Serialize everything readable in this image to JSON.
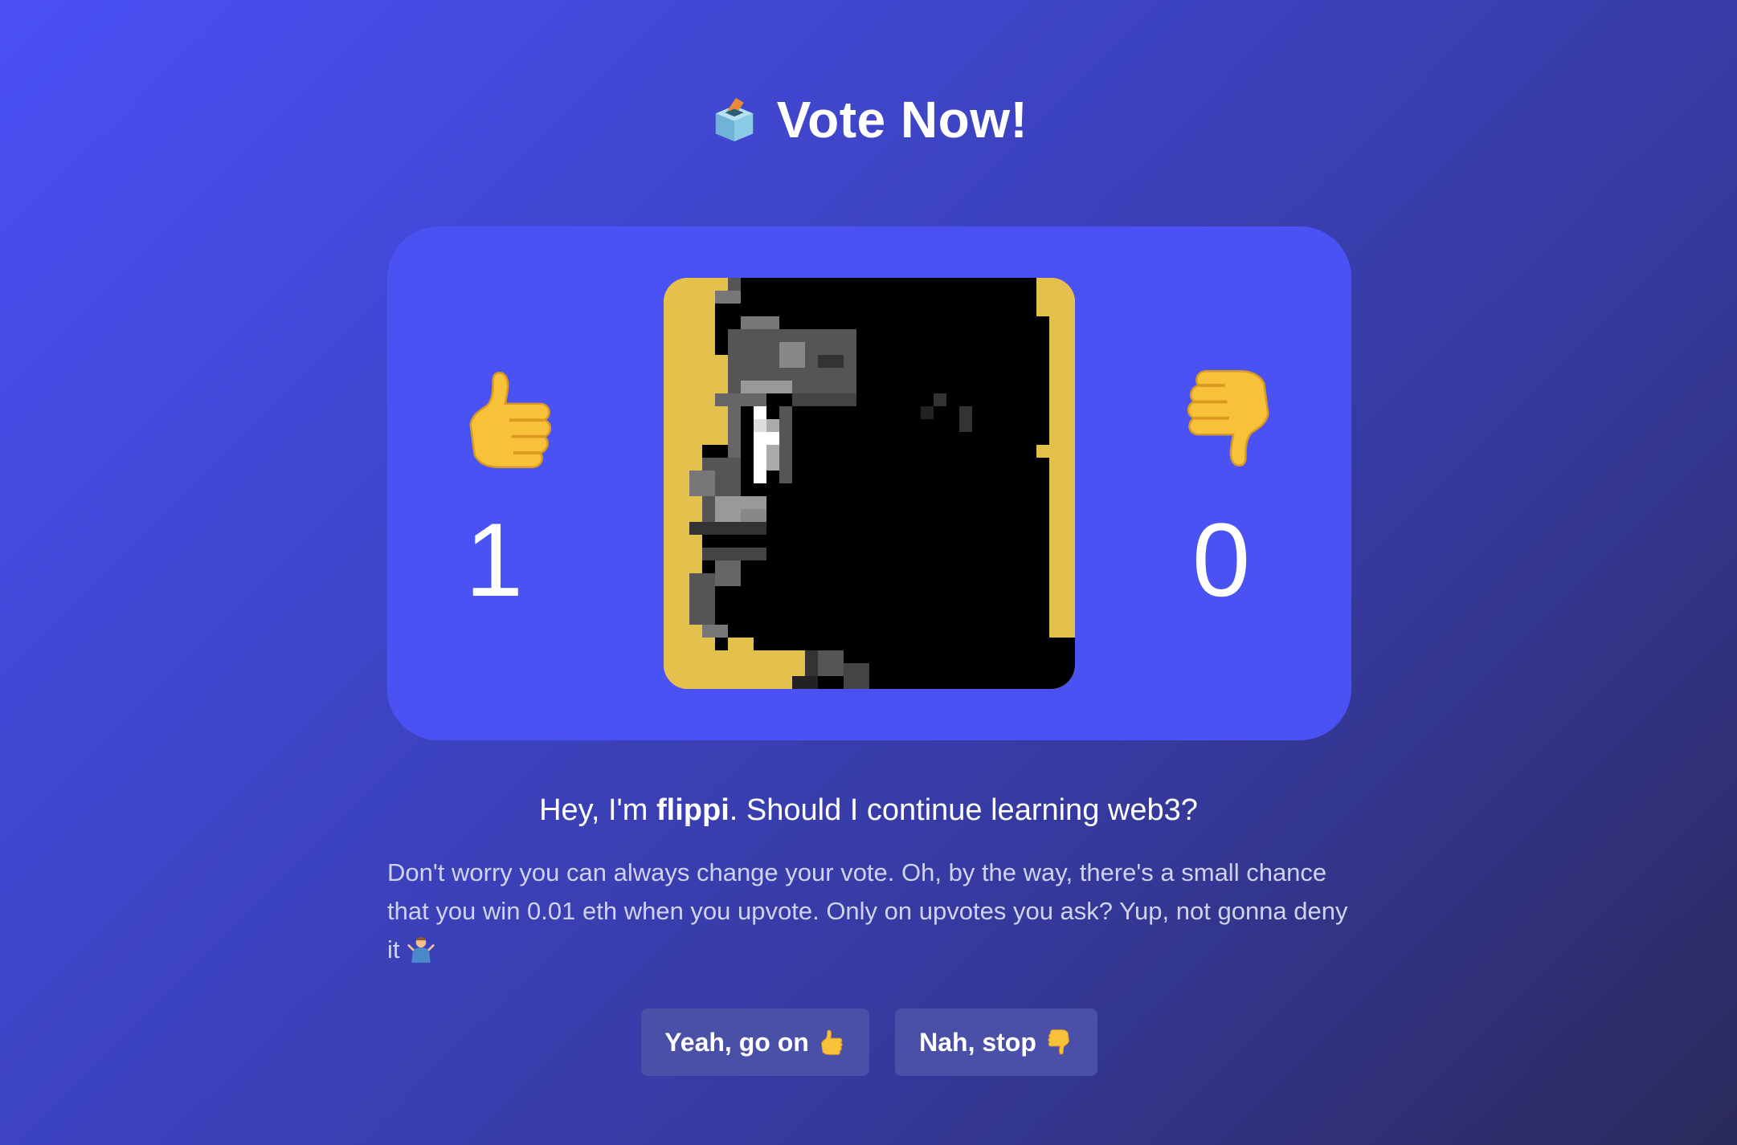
{
  "header": {
    "title": "Vote Now!",
    "icon": "ballot-box-icon"
  },
  "votes": {
    "up_count": "1",
    "down_count": "0",
    "up_icon": "thumbs-up-icon",
    "down_icon": "thumbs-down-icon"
  },
  "avatar": {
    "icon": "pixel-avatar-icon",
    "background_color": "#e6c04d"
  },
  "question": {
    "prefix": "Hey, I'm ",
    "name": "flippi",
    "suffix": ". Should I continue learning web3?"
  },
  "note": {
    "text": "Don't worry you can always change your vote. Oh, by the way, there's a small chance that you win 0.01 eth when you upvote. Only on upvotes you ask? Yup, not gonna deny it",
    "icon": "shrug-icon"
  },
  "buttons": {
    "yes_label": "Yeah, go on",
    "no_label": "Nah, stop"
  },
  "colors": {
    "accent": "#4a52f4",
    "button": "#4a4fa8"
  }
}
